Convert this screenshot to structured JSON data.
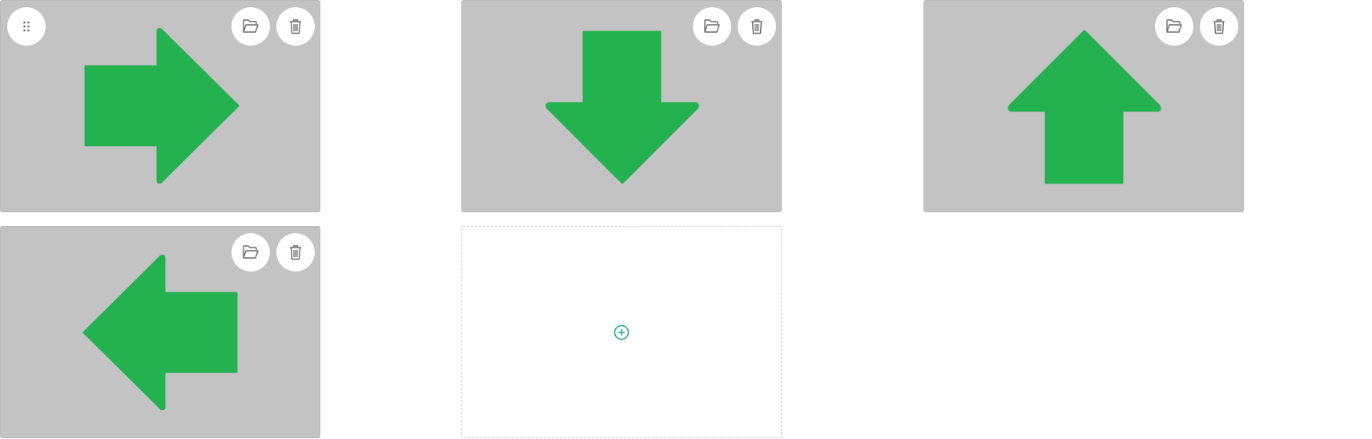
{
  "colors": {
    "tile_background": "#c3c3c3",
    "arrow_fill": "#24b14f",
    "icon_stroke": "#6b6b6b",
    "add_accent": "#1aa889",
    "button_background": "#ffffff"
  },
  "gallery": {
    "items": [
      {
        "arrow": "right",
        "icons": [
          "folder-open-icon",
          "trash-icon"
        ]
      },
      {
        "arrow": "down",
        "icons": [
          "folder-open-icon",
          "trash-icon"
        ]
      },
      {
        "arrow": "up",
        "icons": [
          "folder-open-icon",
          "trash-icon"
        ]
      },
      {
        "arrow": "left",
        "icons": [
          "folder-open-icon",
          "trash-icon"
        ]
      }
    ],
    "drag_handle_icon": "grip-dots-icon",
    "add_slot_icon": "plus-circle-icon"
  }
}
